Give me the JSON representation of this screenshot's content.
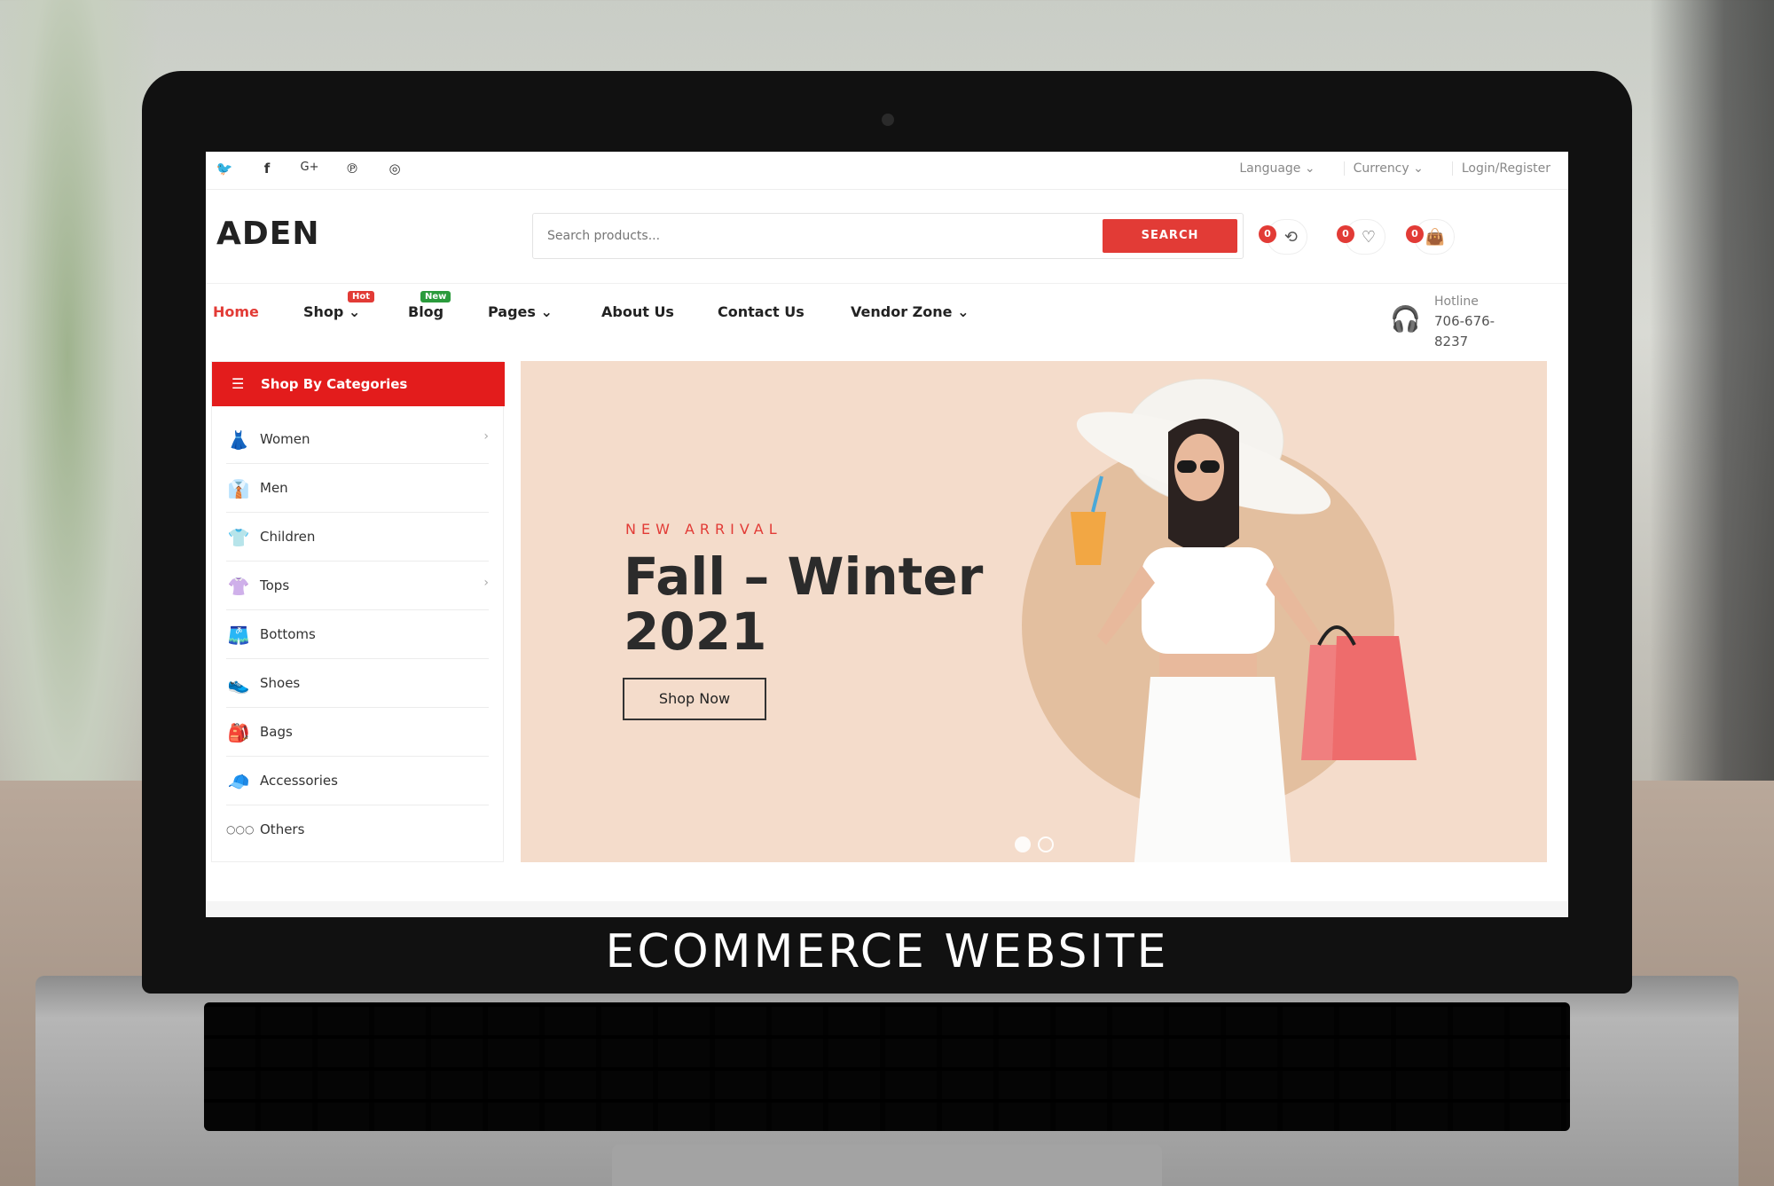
{
  "caption": "ECOMMERCE WEBSITE",
  "topbar": {
    "socials": [
      "twitter-icon",
      "facebook-icon",
      "google-plus-icon",
      "pinterest-icon",
      "instagram-icon"
    ],
    "language": "Language ⌄",
    "currency": "Currency ⌄",
    "login": "Login/Register"
  },
  "header": {
    "logo": "ADEN",
    "search_placeholder": "Search products...",
    "search_button": "SEARCH",
    "compare_count": "0",
    "wishlist_count": "0",
    "cart_count": "0"
  },
  "nav": {
    "items": [
      {
        "label": "Home",
        "active": true
      },
      {
        "label": "Shop ⌄",
        "tag": "Hot"
      },
      {
        "label": "Blog",
        "tag": "New"
      },
      {
        "label": "Pages ⌄"
      },
      {
        "label": "About Us"
      },
      {
        "label": "Contact Us"
      },
      {
        "label": "Vendor Zone ⌄"
      }
    ],
    "hotline_label": "Hotline",
    "hotline_number": "706-676-8237"
  },
  "sidebar": {
    "title": "Shop By Categories",
    "items": [
      {
        "label": "Women",
        "arrow": "›"
      },
      {
        "label": "Men",
        "arrow": ""
      },
      {
        "label": "Children",
        "arrow": ""
      },
      {
        "label": "Tops",
        "arrow": "›"
      },
      {
        "label": "Bottoms",
        "arrow": ""
      },
      {
        "label": "Shoes",
        "arrow": ""
      },
      {
        "label": "Bags",
        "arrow": ""
      },
      {
        "label": "Accessories",
        "arrow": ""
      },
      {
        "label": "Others",
        "arrow": ""
      }
    ]
  },
  "banner": {
    "eyebrow": "NEW ARRIVAL",
    "title": "Fall – Winter 2021",
    "button": "Shop Now"
  },
  "colors": {
    "accent": "#e23b36",
    "banner_bg": "#f4dccb"
  }
}
